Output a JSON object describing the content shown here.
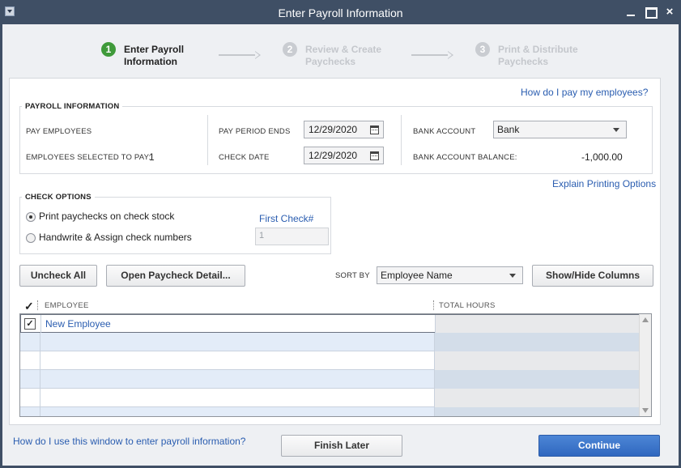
{
  "window": {
    "title": "Enter Payroll Information"
  },
  "steps": [
    {
      "number": "1",
      "label_line1": "Enter Payroll",
      "label_line2": "Information",
      "state": "active"
    },
    {
      "number": "2",
      "label_line1": "Review & Create",
      "label_line2": "Paychecks",
      "state": "inactive"
    },
    {
      "number": "3",
      "label_line1": "Print & Distribute",
      "label_line2": "Paychecks",
      "state": "inactive"
    }
  ],
  "help_link_top": "How do I pay my employees?",
  "payroll_info": {
    "title": "PAYROLL INFORMATION",
    "pay_employees_label": "PAY EMPLOYEES",
    "employees_selected_label": "EMPLOYEES SELECTED TO PAY:",
    "employees_selected_value": "1",
    "pay_period_ends_label": "PAY PERIOD ENDS",
    "pay_period_ends_value": "12/29/2020",
    "check_date_label": "CHECK DATE",
    "check_date_value": "12/29/2020",
    "bank_account_label": "BANK ACCOUNT",
    "bank_account_value": "Bank",
    "bank_balance_label": "BANK ACCOUNT BALANCE:",
    "bank_balance_value": "-1,000.00"
  },
  "explain_printing_link": "Explain Printing Options",
  "check_options": {
    "title": "CHECK OPTIONS",
    "option_print": "Print paychecks on check stock",
    "option_handwrite": "Handwrite & Assign check numbers",
    "selected": "print",
    "first_check_label": "First Check#",
    "first_check_value": "1"
  },
  "toolbar": {
    "uncheck_all": "Uncheck All",
    "open_paycheck_detail": "Open Paycheck Detail...",
    "sort_by_label": "SORT BY",
    "sort_by_value": "Employee Name",
    "show_hide_columns": "Show/Hide Columns"
  },
  "table": {
    "check_header": "✓",
    "columns": [
      "EMPLOYEE",
      "TOTAL HOURS"
    ],
    "rows": [
      {
        "checked": true,
        "employee": "New Employee",
        "total_hours": ""
      }
    ]
  },
  "footer": {
    "help_link": "How do I use this window to enter payroll information?",
    "finish_later": "Finish Later",
    "continue": "Continue"
  },
  "colors": {
    "titlebar": "#3f4f65",
    "step_active": "#3f9a3a",
    "link": "#2a5db0",
    "primary_button": "#2f67bf",
    "row_alt": "#e3ecf8"
  }
}
